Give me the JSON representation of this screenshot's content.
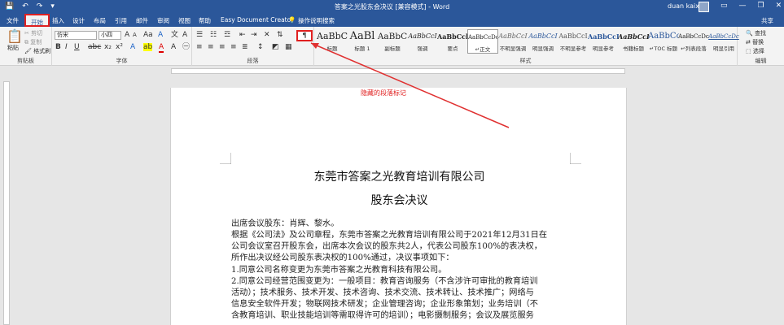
{
  "titlebar": {
    "qa_save": "💾",
    "qa_undo": "↶",
    "qa_redo": "↷",
    "qa_custom": "▾",
    "title": "答案之光股东会决议 [兼容模式] - Word",
    "user": "duan kaixin",
    "min": "—",
    "restore": "❐",
    "close": "✕",
    "ribbon_opt": "▭"
  },
  "tabs": {
    "items": [
      "文件",
      "开始",
      "插入",
      "设计",
      "布局",
      "引用",
      "邮件",
      "审阅",
      "视图",
      "帮助",
      "Easy Document Creator"
    ],
    "tellme": "操作说明搜索",
    "share": "共享"
  },
  "ribbon": {
    "clipboard": {
      "paste": "粘贴",
      "cut": "剪切",
      "copy": "复制",
      "format_painter": "格式刷",
      "label": "剪贴板"
    },
    "font": {
      "name": "仿宋",
      "size": "小四",
      "label": "字体"
    },
    "paragraph": {
      "label": "段落"
    },
    "styles": {
      "label": "样式",
      "items": [
        {
          "sample": "AaBbC",
          "name": "标题"
        },
        {
          "sample": "AaBl",
          "name": "标题 1"
        },
        {
          "sample": "AaBbC",
          "name": "副标题"
        },
        {
          "sample": "AaBbCcI",
          "name": "强调"
        },
        {
          "sample": "AaBbCcl",
          "name": "要点"
        },
        {
          "sample": "AaBbCcDc",
          "name": "↵正文"
        },
        {
          "sample": "AaBbCcI",
          "name": "不明显强调"
        },
        {
          "sample": "AaBbCcI",
          "name": "明显强调"
        },
        {
          "sample": "AaBbCcI",
          "name": "不明显参考"
        },
        {
          "sample": "AaBbCcI",
          "name": "明显参考"
        },
        {
          "sample": "AaBbCcI",
          "name": "书籍标题"
        },
        {
          "sample": "AaBbCc",
          "name": "↵TOC 标题"
        },
        {
          "sample": "AaBbCcDc",
          "name": "↵列表段落"
        },
        {
          "sample": "AaBbCcDc",
          "name": "明显引用"
        }
      ]
    },
    "editing": {
      "find": "查找",
      "replace": "替换",
      "select": "选择",
      "label": "编辑"
    }
  },
  "annotation": "隐藏的段落标记",
  "document": {
    "title": "东莞市答案之光教育培训有限公司",
    "subtitle": "股东会决议",
    "lines": [
      "出席会议股东：肖辉、黎水。",
      "根据《公司法》及公司章程，东莞市答案之光教育培训有限公司于2021年12月31日在",
      "公司会议室召开股东会，出席本次会议的股东共2人，代表公司股东100%的表决权，",
      "所作出决议经公司股东表决权的100%通过，决议事项如下：",
      "1.同意公司名称变更为东莞市答案之光教育科技有限公司。",
      "2.同意公司经营范围变更为：一般项目：教育咨询服务（不含涉许可审批的教育培训",
      "活动）；技术服务、技术开发、技术咨询、技术交流、技术转让、技术推广；网络与",
      "信息安全软件开发；物联网技术研发；企业管理咨询；企业形象策划；业务培训（不",
      "含教育培训、职业技能培训等需取得许可的培训）；电影摄制服务；会议及展览服务"
    ]
  }
}
